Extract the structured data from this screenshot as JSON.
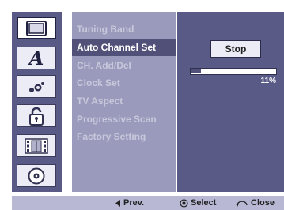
{
  "icon_column": {
    "items": [
      {
        "name": "tv-icon",
        "active": true
      },
      {
        "name": "language-icon",
        "active": false
      },
      {
        "name": "audio-icon",
        "active": false
      },
      {
        "name": "lock-icon",
        "active": false
      },
      {
        "name": "recording-icon",
        "active": false
      },
      {
        "name": "disc-icon",
        "active": false
      }
    ],
    "language_glyph": "A"
  },
  "menu": {
    "items": [
      {
        "label": "Tuning Band",
        "active": false
      },
      {
        "label": "Auto Channel Set",
        "active": true
      },
      {
        "label": "CH. Add/Del",
        "active": false
      },
      {
        "label": "Clock Set",
        "active": false
      },
      {
        "label": "TV Aspect",
        "active": false
      },
      {
        "label": "Progressive Scan",
        "active": false
      },
      {
        "label": "Factory Setting",
        "active": false
      }
    ]
  },
  "panel": {
    "stop_label": "Stop",
    "progress_percent": 11,
    "progress_label": "11%"
  },
  "footer": {
    "prev_label": "Prev.",
    "select_label": "Select",
    "close_label": "Close"
  },
  "colors": {
    "panel_bg": "#5a5a86",
    "menu_bg": "#9a9abc",
    "highlight": "#505078",
    "footer_bg": "#b8b8d4"
  }
}
